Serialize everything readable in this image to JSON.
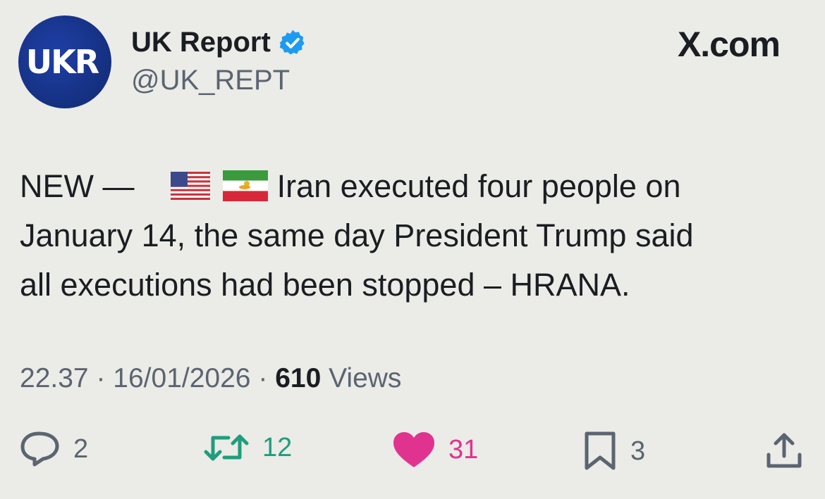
{
  "avatar": {
    "text": "UKR"
  },
  "account": {
    "display_name": "UK Report",
    "handle": "@UK_REPT",
    "verified": true
  },
  "brand": {
    "label": "X.com"
  },
  "tweet": {
    "prefix": "NEW —",
    "flags": [
      "us-flag",
      "iran-lion-sun-flag"
    ],
    "line1": "Iran executed four people on",
    "line2": "January 14, the same day President Trump said",
    "line3": "all executions had been stopped – HRANA."
  },
  "meta": {
    "time": "22.37",
    "date": "16/01/2026",
    "views_count": "610",
    "views_label": "Views",
    "separator": "·"
  },
  "actions": {
    "reply_count": "2",
    "retweet_count": "12",
    "like_count": "31",
    "bookmark_count": "3"
  },
  "colors": {
    "background": "#ebebe7",
    "verified_blue": "#1d9bf0",
    "retweet_green": "#1f9d7c",
    "like_pink": "#e0338f",
    "secondary_text": "#5b6470"
  }
}
